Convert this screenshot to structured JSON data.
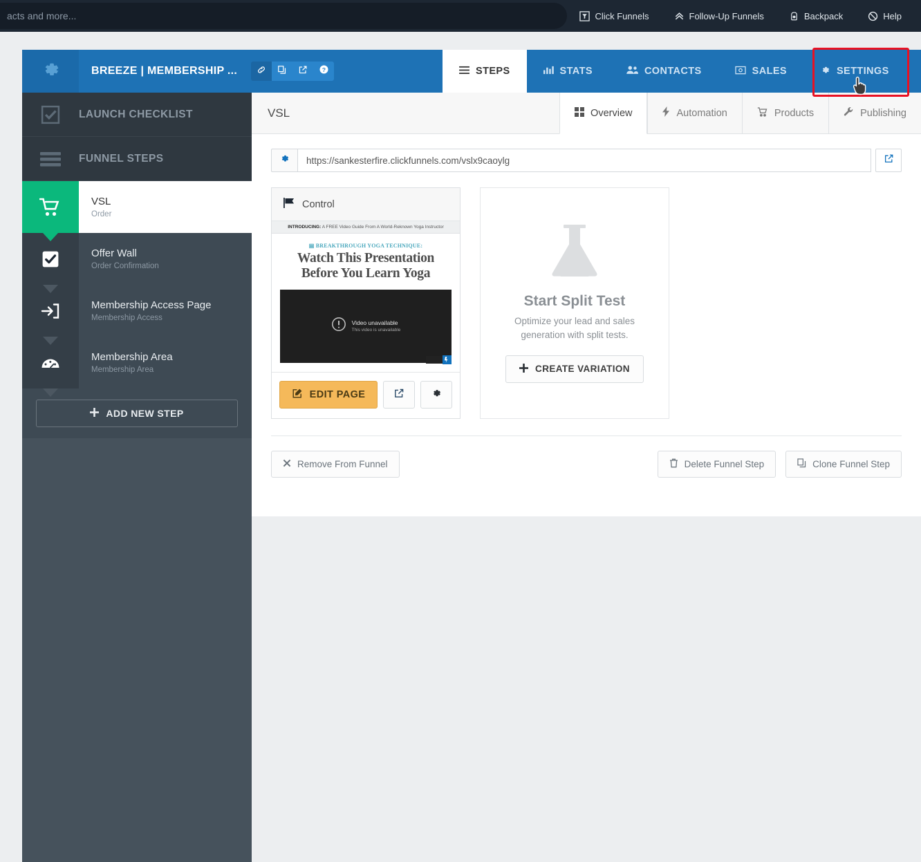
{
  "topbar": {
    "search_placeholder": "acts and more...",
    "search_value": "",
    "nav": [
      {
        "label": "Click Funnels",
        "icon": "clickfunnels-icon"
      },
      {
        "label": "Follow-Up Funnels",
        "icon": "chevrons-up-icon"
      },
      {
        "label": "Backpack",
        "icon": "backpack-icon"
      },
      {
        "label": "Help",
        "icon": "help-icon"
      }
    ]
  },
  "header": {
    "funnel_title": "BREEZE | MEMBERSHIP ...",
    "gear_icon": "gear-icon",
    "actions": [
      {
        "icon": "link-icon"
      },
      {
        "icon": "copy-icon"
      },
      {
        "icon": "external-link-icon"
      },
      {
        "icon": "question-circle-icon"
      }
    ],
    "tabs": [
      {
        "label": "STEPS",
        "icon": "hamburger-icon",
        "active": true
      },
      {
        "label": "STATS",
        "icon": "bar-chart-icon",
        "active": false
      },
      {
        "label": "CONTACTS",
        "icon": "users-icon",
        "active": false
      },
      {
        "label": "SALES",
        "icon": "money-icon",
        "active": false
      },
      {
        "label": "SETTINGS",
        "icon": "gear-icon",
        "active": false,
        "highlighted": true
      }
    ]
  },
  "sidebar": {
    "launch_checklist": "LAUNCH CHECKLIST",
    "funnel_steps": "FUNNEL STEPS",
    "steps": [
      {
        "name": "VSL",
        "type": "Order",
        "icon": "cart-icon",
        "active": true
      },
      {
        "name": "Offer Wall",
        "type": "Order Confirmation",
        "icon": "check-square-icon",
        "active": false
      },
      {
        "name": "Membership Access Page",
        "type": "Membership Access",
        "icon": "sign-in-icon",
        "active": false
      },
      {
        "name": "Membership Area",
        "type": "Membership Area",
        "icon": "dashboard-icon",
        "active": false
      }
    ],
    "add_new_step": "ADD NEW STEP"
  },
  "content": {
    "step_name": "VSL",
    "subtabs": [
      {
        "label": "Overview",
        "icon": "grid-icon",
        "active": true
      },
      {
        "label": "Automation",
        "icon": "bolt-icon",
        "active": false
      },
      {
        "label": "Products",
        "icon": "cart-icon",
        "active": false
      },
      {
        "label": "Publishing",
        "icon": "wrench-icon",
        "active": false
      }
    ],
    "url": "https://sankesterfire.clickfunnels.com/vslx9caoylg",
    "control_card": {
      "title": "Control",
      "flag_icon": "flag-icon",
      "preview": {
        "strip_bold": "INTRODUCING:",
        "strip_text": "A FREE Video Guide From A World-Reknown Yoga Instructor",
        "eyebrow": "BREAKTHROUGH YOGA TECHNIQUE:",
        "headline_line1": "Watch This Presentation",
        "headline_line2": "Before You Learn Yoga",
        "video_title": "Video unavailable",
        "video_sub": "This video is unavailable"
      },
      "edit_page_label": "EDIT PAGE",
      "preview_icon": "external-link-icon",
      "settings_icon": "gear-icon"
    },
    "split_test": {
      "icon": "flask-icon",
      "title": "Start Split Test",
      "description": "Optimize your lead and sales generation with split tests.",
      "button_label": "CREATE VARIATION"
    },
    "bottom_actions": {
      "remove": "Remove From Funnel",
      "delete": "Delete Funnel Step",
      "clone": "Clone Funnel Step"
    }
  },
  "colors": {
    "topbar": "#1d2733",
    "brand_blue": "#1e72b5",
    "sidebar": "#3e4a54",
    "active_step_green": "#0bb87c",
    "edit_button": "#f5b95a",
    "highlight_red": "#e81123"
  }
}
